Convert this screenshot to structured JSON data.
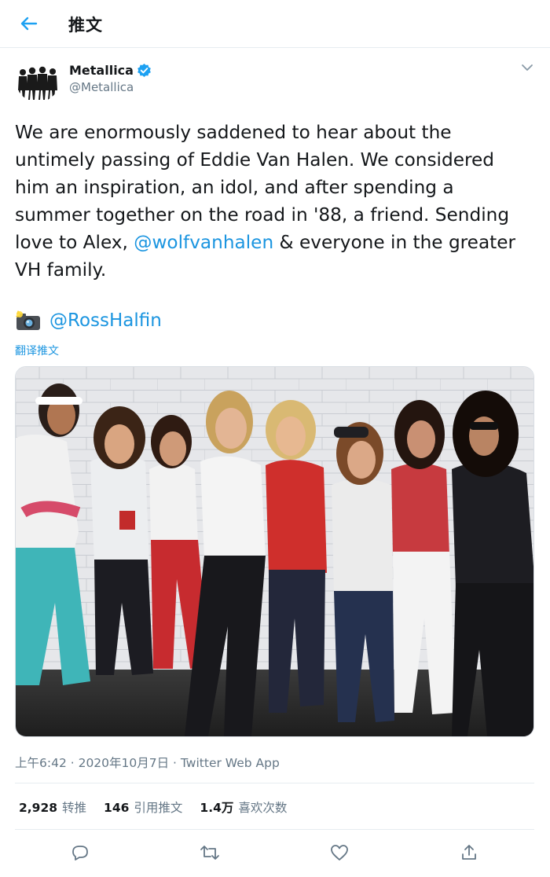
{
  "header": {
    "title": "推文",
    "back_icon": "back-arrow-icon"
  },
  "author": {
    "name": "Metallica",
    "handle": "@Metallica",
    "verified": true
  },
  "tweet": {
    "text_before_mention": "We are enormously saddened to hear about the untimely passing of Eddie Van Halen. We considered him an inspiration, an idol, and after spending a summer together on the road in '88, a friend. Sending love to Alex, ",
    "mention": "@wolfvanhalen",
    "text_after_mention": " & everyone in the greater VH family.",
    "credit_emoji": "camera-flash-emoji",
    "credit_handle": "@RossHalfin",
    "translate_label": "翻译推文"
  },
  "meta": {
    "timestamp": "上午6:42 · 2020年10月7日 · Twitter Web App"
  },
  "stats": {
    "retweets_count": "2,928",
    "retweets_label": "转推",
    "quotes_count": "146",
    "quotes_label": "引用推文",
    "likes_count": "1.4万",
    "likes_label": "喜欢次数"
  },
  "actions": [
    "reply-icon",
    "retweet-icon",
    "like-icon",
    "share-icon"
  ],
  "colors": {
    "accent": "#1da1f2",
    "link": "#1b95e0",
    "text": "#14171a",
    "muted": "#657786",
    "border": "#e6ecf0"
  }
}
